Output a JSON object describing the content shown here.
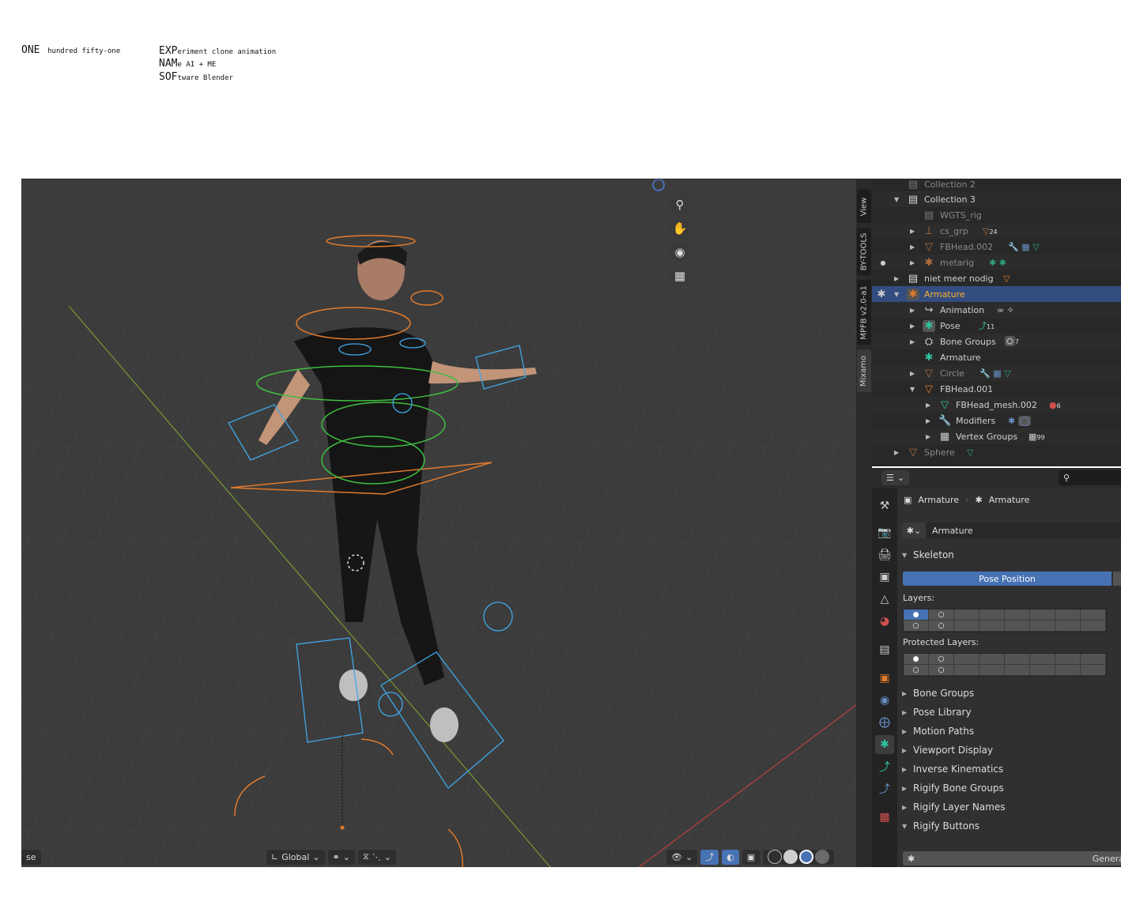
{
  "header": {
    "left_big": "ONE",
    "left_small": "hundred fifty-one",
    "rows": [
      {
        "big": "EXP",
        "small": "eriment clone animation"
      },
      {
        "big": "NAM",
        "small": "e AI + ME"
      },
      {
        "big": "SOF",
        "small": "tware Blender"
      }
    ]
  },
  "viewport": {
    "mode_label": "se",
    "transform_orientation": "Global",
    "nav_icons": [
      "zoom-icon",
      "hand-pan-icon",
      "camera-icon",
      "grid-perspective-icon"
    ]
  },
  "side_tabs": [
    "View",
    "BY-TOOLS",
    "MPFB v2.0-a1",
    "Mixamo"
  ],
  "outliner": {
    "rows": [
      {
        "label": "Collection 2",
        "icon": "collection-icon",
        "dim": true
      },
      {
        "label": "Collection 3",
        "icon": "collection-icon",
        "dim": false
      },
      {
        "label": "WGTS_rig",
        "icon": "collection-icon",
        "dim": true
      },
      {
        "label": "cs_grp",
        "icon": "empty-icon",
        "dim": true,
        "count": "24"
      },
      {
        "label": "FBHead.002",
        "icon": "mesh-object-icon",
        "dim": true
      },
      {
        "label": "metarig",
        "icon": "armature-object-icon",
        "dim": true
      },
      {
        "label": "niet meer nodig",
        "icon": "collection-icon",
        "dim": false
      },
      {
        "label": "Armature",
        "icon": "armature-object-icon",
        "dim": false
      },
      {
        "label": "Animation",
        "icon": "animation-icon",
        "dim": false
      },
      {
        "label": "Pose",
        "icon": "pose-icon",
        "dim": false,
        "count": "11"
      },
      {
        "label": "Bone Groups",
        "icon": "bone-groups-icon",
        "dim": false,
        "count": "7"
      },
      {
        "label": "Armature",
        "icon": "armature-data-icon",
        "dim": false
      },
      {
        "label": "Circle",
        "icon": "mesh-object-icon",
        "dim": true
      },
      {
        "label": "FBHead.001",
        "icon": "mesh-object-icon",
        "dim": false
      },
      {
        "label": "FBHead_mesh.002",
        "icon": "mesh-data-icon",
        "dim": false,
        "count": "6"
      },
      {
        "label": "Modifiers",
        "icon": "wrench-icon",
        "dim": false
      },
      {
        "label": "Vertex Groups",
        "icon": "vertex-groups-icon",
        "dim": false,
        "count": "99"
      },
      {
        "label": "Sphere",
        "icon": "mesh-object-icon",
        "dim": true
      }
    ]
  },
  "properties": {
    "breadcrumb": [
      "Armature",
      "Armature"
    ],
    "datablock_name": "Armature",
    "skeleton_label": "Skeleton",
    "pose_position_label": "Pose Position",
    "layers_label": "Layers:",
    "protected_layers_label": "Protected Layers:",
    "panels": [
      "Bone Groups",
      "Pose Library",
      "Motion Paths",
      "Viewport Display",
      "Inverse Kinematics",
      "Rigify Bone Groups",
      "Rigify Layer Names",
      "Rigify Buttons"
    ],
    "bottom_button": "Genera"
  },
  "colors": {
    "accent": "#4772b3",
    "selected_row": "#334d80",
    "armature_orange": "#e07a2c",
    "bone_blue": "#3fa7e8",
    "bone_green": "#3fbf3f"
  }
}
